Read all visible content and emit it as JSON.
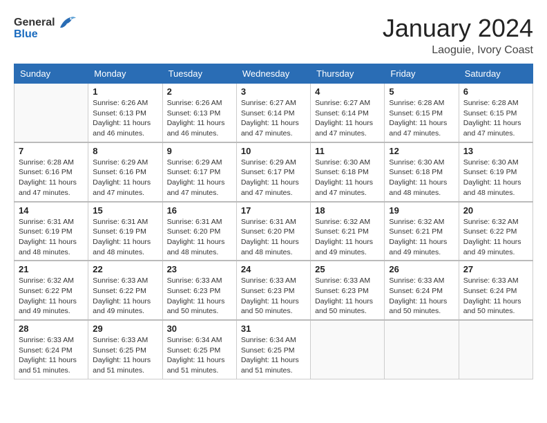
{
  "header": {
    "logo_general": "General",
    "logo_blue": "Blue",
    "month_year": "January 2024",
    "location": "Laoguie, Ivory Coast"
  },
  "calendar": {
    "days_of_week": [
      "Sunday",
      "Monday",
      "Tuesday",
      "Wednesday",
      "Thursday",
      "Friday",
      "Saturday"
    ],
    "weeks": [
      [
        {
          "day": "",
          "info": ""
        },
        {
          "day": "1",
          "info": "Sunrise: 6:26 AM\nSunset: 6:13 PM\nDaylight: 11 hours\nand 46 minutes."
        },
        {
          "day": "2",
          "info": "Sunrise: 6:26 AM\nSunset: 6:13 PM\nDaylight: 11 hours\nand 46 minutes."
        },
        {
          "day": "3",
          "info": "Sunrise: 6:27 AM\nSunset: 6:14 PM\nDaylight: 11 hours\nand 47 minutes."
        },
        {
          "day": "4",
          "info": "Sunrise: 6:27 AM\nSunset: 6:14 PM\nDaylight: 11 hours\nand 47 minutes."
        },
        {
          "day": "5",
          "info": "Sunrise: 6:28 AM\nSunset: 6:15 PM\nDaylight: 11 hours\nand 47 minutes."
        },
        {
          "day": "6",
          "info": "Sunrise: 6:28 AM\nSunset: 6:15 PM\nDaylight: 11 hours\nand 47 minutes."
        }
      ],
      [
        {
          "day": "7",
          "info": "Sunrise: 6:28 AM\nSunset: 6:16 PM\nDaylight: 11 hours\nand 47 minutes."
        },
        {
          "day": "8",
          "info": "Sunrise: 6:29 AM\nSunset: 6:16 PM\nDaylight: 11 hours\nand 47 minutes."
        },
        {
          "day": "9",
          "info": "Sunrise: 6:29 AM\nSunset: 6:17 PM\nDaylight: 11 hours\nand 47 minutes."
        },
        {
          "day": "10",
          "info": "Sunrise: 6:29 AM\nSunset: 6:17 PM\nDaylight: 11 hours\nand 47 minutes."
        },
        {
          "day": "11",
          "info": "Sunrise: 6:30 AM\nSunset: 6:18 PM\nDaylight: 11 hours\nand 47 minutes."
        },
        {
          "day": "12",
          "info": "Sunrise: 6:30 AM\nSunset: 6:18 PM\nDaylight: 11 hours\nand 48 minutes."
        },
        {
          "day": "13",
          "info": "Sunrise: 6:30 AM\nSunset: 6:19 PM\nDaylight: 11 hours\nand 48 minutes."
        }
      ],
      [
        {
          "day": "14",
          "info": "Sunrise: 6:31 AM\nSunset: 6:19 PM\nDaylight: 11 hours\nand 48 minutes."
        },
        {
          "day": "15",
          "info": "Sunrise: 6:31 AM\nSunset: 6:19 PM\nDaylight: 11 hours\nand 48 minutes."
        },
        {
          "day": "16",
          "info": "Sunrise: 6:31 AM\nSunset: 6:20 PM\nDaylight: 11 hours\nand 48 minutes."
        },
        {
          "day": "17",
          "info": "Sunrise: 6:31 AM\nSunset: 6:20 PM\nDaylight: 11 hours\nand 48 minutes."
        },
        {
          "day": "18",
          "info": "Sunrise: 6:32 AM\nSunset: 6:21 PM\nDaylight: 11 hours\nand 49 minutes."
        },
        {
          "day": "19",
          "info": "Sunrise: 6:32 AM\nSunset: 6:21 PM\nDaylight: 11 hours\nand 49 minutes."
        },
        {
          "day": "20",
          "info": "Sunrise: 6:32 AM\nSunset: 6:22 PM\nDaylight: 11 hours\nand 49 minutes."
        }
      ],
      [
        {
          "day": "21",
          "info": "Sunrise: 6:32 AM\nSunset: 6:22 PM\nDaylight: 11 hours\nand 49 minutes."
        },
        {
          "day": "22",
          "info": "Sunrise: 6:33 AM\nSunset: 6:22 PM\nDaylight: 11 hours\nand 49 minutes."
        },
        {
          "day": "23",
          "info": "Sunrise: 6:33 AM\nSunset: 6:23 PM\nDaylight: 11 hours\nand 50 minutes."
        },
        {
          "day": "24",
          "info": "Sunrise: 6:33 AM\nSunset: 6:23 PM\nDaylight: 11 hours\nand 50 minutes."
        },
        {
          "day": "25",
          "info": "Sunrise: 6:33 AM\nSunset: 6:23 PM\nDaylight: 11 hours\nand 50 minutes."
        },
        {
          "day": "26",
          "info": "Sunrise: 6:33 AM\nSunset: 6:24 PM\nDaylight: 11 hours\nand 50 minutes."
        },
        {
          "day": "27",
          "info": "Sunrise: 6:33 AM\nSunset: 6:24 PM\nDaylight: 11 hours\nand 50 minutes."
        }
      ],
      [
        {
          "day": "28",
          "info": "Sunrise: 6:33 AM\nSunset: 6:24 PM\nDaylight: 11 hours\nand 51 minutes."
        },
        {
          "day": "29",
          "info": "Sunrise: 6:33 AM\nSunset: 6:25 PM\nDaylight: 11 hours\nand 51 minutes."
        },
        {
          "day": "30",
          "info": "Sunrise: 6:34 AM\nSunset: 6:25 PM\nDaylight: 11 hours\nand 51 minutes."
        },
        {
          "day": "31",
          "info": "Sunrise: 6:34 AM\nSunset: 6:25 PM\nDaylight: 11 hours\nand 51 minutes."
        },
        {
          "day": "",
          "info": ""
        },
        {
          "day": "",
          "info": ""
        },
        {
          "day": "",
          "info": ""
        }
      ]
    ]
  }
}
